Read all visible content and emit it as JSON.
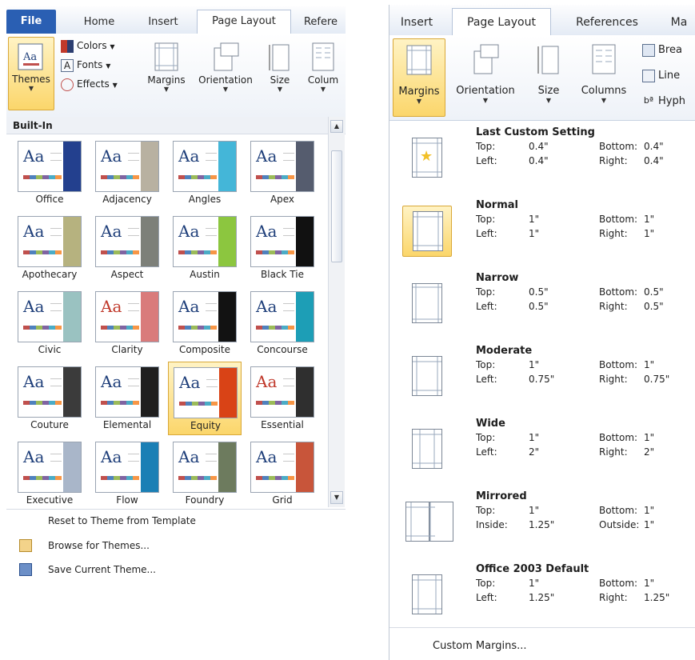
{
  "left": {
    "tabs": [
      "File",
      "Home",
      "Insert",
      "Page Layout",
      "Refere"
    ],
    "ribbon": {
      "themes_label": "Themes",
      "colors_label": "Colors",
      "fonts_label": "Fonts",
      "effects_label": "Effects",
      "margins_label": "Margins",
      "orientation_label": "Orientation",
      "size_label": "Size",
      "columns_label": "Colum"
    },
    "gallery_header": "Built-In",
    "themes": [
      {
        "name": "Office",
        "aa": "Aa",
        "band": "#23408e"
      },
      {
        "name": "Adjacency",
        "aa": "Aa",
        "band": "#b8b1a1"
      },
      {
        "name": "Angles",
        "aa": "Aa",
        "band": "#44b6d8"
      },
      {
        "name": "Apex",
        "aa": "Aa",
        "band": "#555c6e"
      },
      {
        "name": "Apothecary",
        "aa": "Aa",
        "band": "#b6b27f"
      },
      {
        "name": "Aspect",
        "aa": "Aa",
        "band": "#7d8079"
      },
      {
        "name": "Austin",
        "aa": "Aa",
        "band": "#8cc63f"
      },
      {
        "name": "Black Tie",
        "aa": "Aa",
        "band": "#111111"
      },
      {
        "name": "Civic",
        "aa": "Aa",
        "band": "#9ac2c1"
      },
      {
        "name": "Clarity",
        "aa": "Aa",
        "band": "#d97b7b"
      },
      {
        "name": "Composite",
        "aa": "Aa",
        "band": "#121212"
      },
      {
        "name": "Concourse",
        "aa": "Aa",
        "band": "#1d9eb6"
      },
      {
        "name": "Couture",
        "aa": "Aa",
        "band": "#3b3b3b"
      },
      {
        "name": "Elemental",
        "aa": "Aa",
        "band": "#1f1f1f"
      },
      {
        "name": "Equity",
        "aa": "Aa",
        "band": "#d94316"
      },
      {
        "name": "Essential",
        "aa": "Aa",
        "band": "#2f2f2f"
      },
      {
        "name": "Executive",
        "aa": "Aa",
        "band": "#a9b6c9"
      },
      {
        "name": "Flow",
        "aa": "Aa",
        "band": "#1a7fb5"
      },
      {
        "name": "Foundry",
        "aa": "Aa",
        "band": "#6d7b5e"
      },
      {
        "name": "Grid",
        "aa": "Aa",
        "band": "#c8553a"
      }
    ],
    "menu": [
      {
        "label": "Reset to Theme from Template",
        "icon": "none"
      },
      {
        "label": "Browse for Themes...",
        "icon": "folder-icon"
      },
      {
        "label": "Save Current Theme...",
        "icon": "save-theme-icon"
      }
    ]
  },
  "right": {
    "tabs": [
      "Insert",
      "Page Layout",
      "References",
      "Ma"
    ],
    "ribbon": {
      "margins_label": "Margins",
      "orientation_label": "Orientation",
      "size_label": "Size",
      "columns_label": "Columns",
      "breaks_label": "Brea",
      "line_numbers_label": "Line",
      "hyphenation_label": "Hyph"
    },
    "options": [
      {
        "title": "Last Custom Setting",
        "k1": "Top:",
        "v1": "0.4\"",
        "k2": "Bottom:",
        "v2": "0.4\"",
        "k3": "Left:",
        "v3": "0.4\"",
        "k4": "Right:",
        "v4": "0.4\""
      },
      {
        "title": "Normal",
        "k1": "Top:",
        "v1": "1\"",
        "k2": "Bottom:",
        "v2": "1\"",
        "k3": "Left:",
        "v3": "1\"",
        "k4": "Right:",
        "v4": "1\""
      },
      {
        "title": "Narrow",
        "k1": "Top:",
        "v1": "0.5\"",
        "k2": "Bottom:",
        "v2": "0.5\"",
        "k3": "Left:",
        "v3": "0.5\"",
        "k4": "Right:",
        "v4": "0.5\""
      },
      {
        "title": "Moderate",
        "k1": "Top:",
        "v1": "1\"",
        "k2": "Bottom:",
        "v2": "1\"",
        "k3": "Left:",
        "v3": "0.75\"",
        "k4": "Right:",
        "v4": "0.75\""
      },
      {
        "title": "Wide",
        "k1": "Top:",
        "v1": "1\"",
        "k2": "Bottom:",
        "v2": "1\"",
        "k3": "Left:",
        "v3": "2\"",
        "k4": "Right:",
        "v4": "2\""
      },
      {
        "title": "Mirrored",
        "k1": "Top:",
        "v1": "1\"",
        "k2": "Bottom:",
        "v2": "1\"",
        "k3": "Inside:",
        "v3": "1.25\"",
        "k4": "Outside:",
        "v4": "1\""
      },
      {
        "title": "Office 2003 Default",
        "k1": "Top:",
        "v1": "1\"",
        "k2": "Bottom:",
        "v2": "1\"",
        "k3": "Left:",
        "v3": "1.25\"",
        "k4": "Right:",
        "v4": "1.25\""
      }
    ],
    "custom_margins": "Custom Margins..."
  },
  "colors": {
    "highlight_border": "#d9a838",
    "file_tab": "#2a5fb3"
  }
}
